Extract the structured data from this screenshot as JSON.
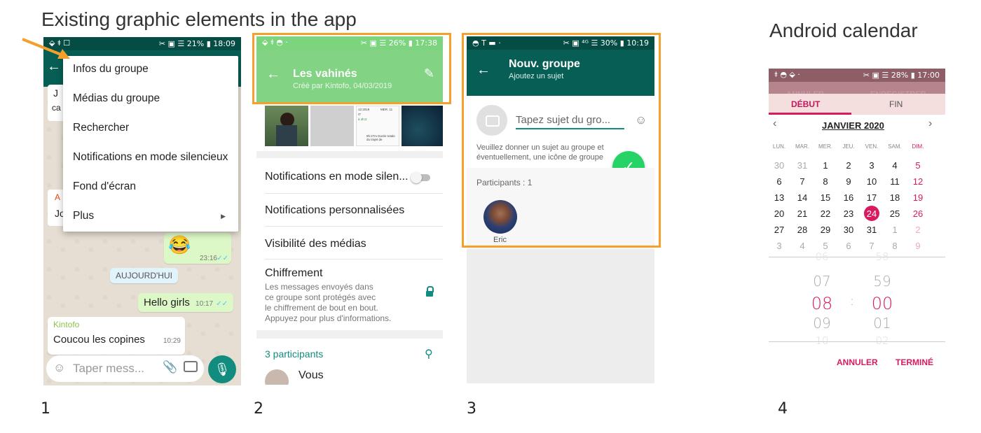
{
  "headings": {
    "existing": "Existing graphic elements in the app",
    "calendar": "Android calendar"
  },
  "labels": [
    "1",
    "2",
    "3",
    "4"
  ],
  "colors": {
    "whatsapp_dark": "#075e54",
    "whatsapp_green": "#25d366",
    "highlight_orange": "#f5a02a",
    "calendar_pink": "#d81b60",
    "calendar_header": "#b6848c"
  },
  "s1": {
    "status_left": "⬙ ⯒ ☐",
    "status_right": "✂ ▣ ☰ 21% ▮ 18:09",
    "menu": [
      "Infos du groupe",
      "Médias du groupe",
      "Rechercher",
      "Notifications en mode silencieux",
      "Fond d'écran",
      "Plus"
    ],
    "partial": [
      "J",
      "ca",
      "A",
      "Jo"
    ],
    "emoji_time": "23:16",
    "date_badge": "AUJOURD'HUI",
    "msg_out": "Hello girls",
    "msg_out_time": "10:17",
    "msg_in_sender": "Kintofo",
    "msg_in": "Coucou les copines",
    "msg_in_time": "10:29",
    "input_placeholder": "Taper mess..."
  },
  "s2": {
    "status_right": "✂ ▣ ☰ 26% ▮ 17:38",
    "title": "Les vahinés",
    "subtitle": "Créé par Kintofo, 04/03/2019",
    "thumb3_lines": [
      "12:2019",
      "IT",
      "à 4h:2",
      "MER. 11",
      "9h:27m Durée totale du trajet de"
    ],
    "settings": [
      "Notifications en mode silen...",
      "Notifications personnalisées",
      "Visibilité des médias"
    ],
    "encryption_title": "Chiffrement",
    "encryption_desc": [
      "Les messages envoyés dans",
      "ce groupe sont protégés avec",
      "le chiffrement de bout en bout.",
      "Appuyez pour plus d'informations."
    ],
    "participants_count": "3 participants",
    "first_participant": "Vous"
  },
  "s3": {
    "status_right": "✂ ▣ ⁴ᴳ ☰ 30% ▮ 10:19",
    "title": "Nouv. groupe",
    "subtitle": "Ajoutez un sujet",
    "subject_placeholder": "Tapez sujet du gro...",
    "hint": [
      "Veuillez donner un sujet au groupe et",
      "éventuellement, une icône de groupe"
    ],
    "participants_label": "Participants : 1",
    "participant_name": "Eric"
  },
  "s4": {
    "status_right": "✂ ▣ ☰ 28% ▮ 17:00",
    "top_actions": [
      "ANNULER",
      "ENREGISTRER"
    ],
    "tabs": [
      "DÉBUT",
      "FIN"
    ],
    "month": "JANVIER 2020",
    "day_headers": [
      "LUN.",
      "MAR.",
      "MER.",
      "JEU.",
      "VEN.",
      "SAM.",
      "DIM."
    ],
    "weeks": [
      [
        "30",
        "31",
        "1",
        "2",
        "3",
        "4",
        "5"
      ],
      [
        "6",
        "7",
        "8",
        "9",
        "10",
        "11",
        "12"
      ],
      [
        "13",
        "14",
        "15",
        "16",
        "17",
        "18",
        "19"
      ],
      [
        "20",
        "21",
        "22",
        "23",
        "24",
        "25",
        "26"
      ],
      [
        "27",
        "28",
        "29",
        "30",
        "31",
        "1",
        "2"
      ],
      [
        "3",
        "4",
        "5",
        "6",
        "7",
        "8",
        "9"
      ]
    ],
    "selected_day": "24",
    "hours": [
      "06",
      "07",
      "08",
      "09",
      "10"
    ],
    "minutes": [
      "58",
      "59",
      "00",
      "01",
      "02"
    ],
    "colon": ":",
    "actions": [
      "ANNULER",
      "TERMINÉ"
    ]
  }
}
